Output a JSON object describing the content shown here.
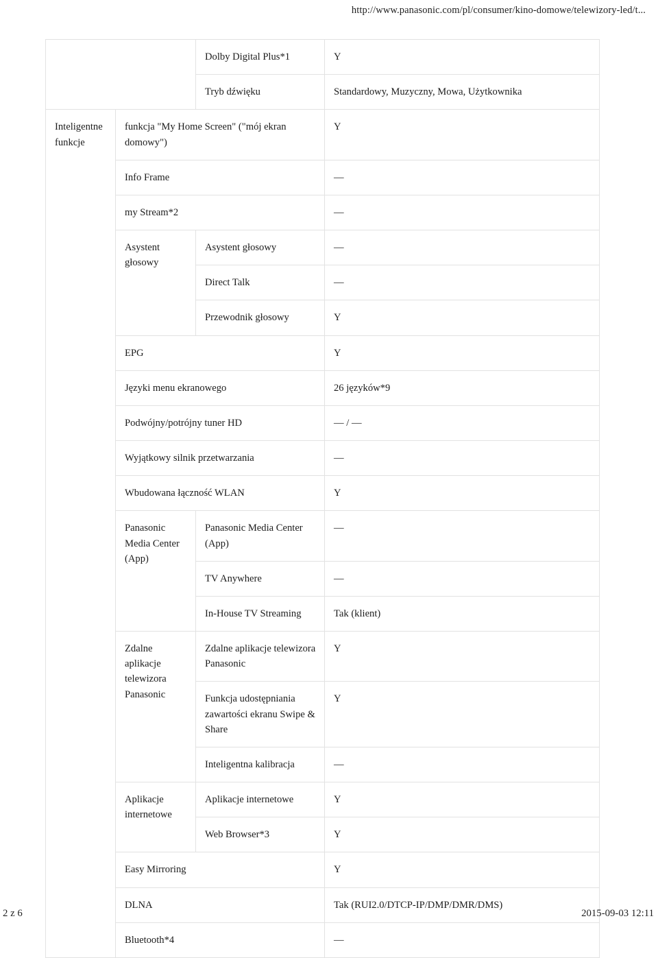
{
  "header": {
    "url": "http://www.panasonic.com/pl/consumer/kino-domowe/telewizory-led/t..."
  },
  "footer": {
    "page_indicator": "2 z 6",
    "timestamp": "2015-09-03 12:11"
  },
  "table": {
    "groups": {
      "inteligentne_funkcje": "Inteligentne funkcje",
      "asystent_glosowy": "Asystent głosowy",
      "panasonic_media_center": "Panasonic Media Center (App)",
      "zdalne_aplikacje": "Zdalne aplikacje telewizora Panasonic",
      "aplikacje_internetowe": "Aplikacje internetowe"
    },
    "rows": {
      "dolby": {
        "name": "Dolby Digital Plus*1",
        "value": "Y"
      },
      "tryb_dzwieku": {
        "name": "Tryb dźwięku",
        "value": "Standardowy, Muzyczny, Mowa, Użytkownika"
      },
      "my_home_screen": {
        "name": "funkcja \"My Home Screen\" (\"mój ekran domowy\")",
        "value": "Y"
      },
      "info_frame": {
        "name": "Info Frame",
        "value": "—"
      },
      "my_stream": {
        "name": "my Stream*2",
        "value": "—"
      },
      "asystent_glosowy_sub": {
        "name": "Asystent głosowy",
        "value": "—"
      },
      "direct_talk": {
        "name": "Direct Talk",
        "value": "—"
      },
      "przewodnik_glosowy": {
        "name": "Przewodnik głosowy",
        "value": "Y"
      },
      "epg": {
        "name": "EPG",
        "value": "Y"
      },
      "jezyki_menu": {
        "name": "Języki menu ekranowego",
        "value": "26 języków*9"
      },
      "tuner_hd": {
        "name": "Podwójny/potrójny tuner HD",
        "value": "— / —"
      },
      "silnik": {
        "name": "Wyjątkowy silnik przetwarzania",
        "value": "—"
      },
      "wlan": {
        "name": "Wbudowana łączność WLAN",
        "value": "Y"
      },
      "pmc_app": {
        "name": "Panasonic Media Center (App)",
        "value": "—"
      },
      "tv_anywhere": {
        "name": "TV Anywhere",
        "value": "—"
      },
      "in_house": {
        "name": "In-House TV Streaming",
        "value": "Tak (klient)"
      },
      "zdalne_sub": {
        "name": "Zdalne aplikacje telewizora Panasonic",
        "value": "Y"
      },
      "swipe_share": {
        "name": "Funkcja udostępniania zawartości ekranu Swipe & Share",
        "value": "Y"
      },
      "inteligentna_kalibracja": {
        "name": "Inteligentna kalibracja",
        "value": "—"
      },
      "aplikacje_internetowe_sub": {
        "name": "Aplikacje internetowe",
        "value": "Y"
      },
      "web_browser": {
        "name": "Web Browser*3",
        "value": "Y"
      },
      "easy_mirroring": {
        "name": "Easy Mirroring",
        "value": "Y"
      },
      "dlna": {
        "name": "DLNA",
        "value": "Tak (RUI2.0/DTCP-IP/DMP/DMR/DMS)"
      },
      "bluetooth": {
        "name": "Bluetooth*4",
        "value": "—"
      }
    }
  }
}
